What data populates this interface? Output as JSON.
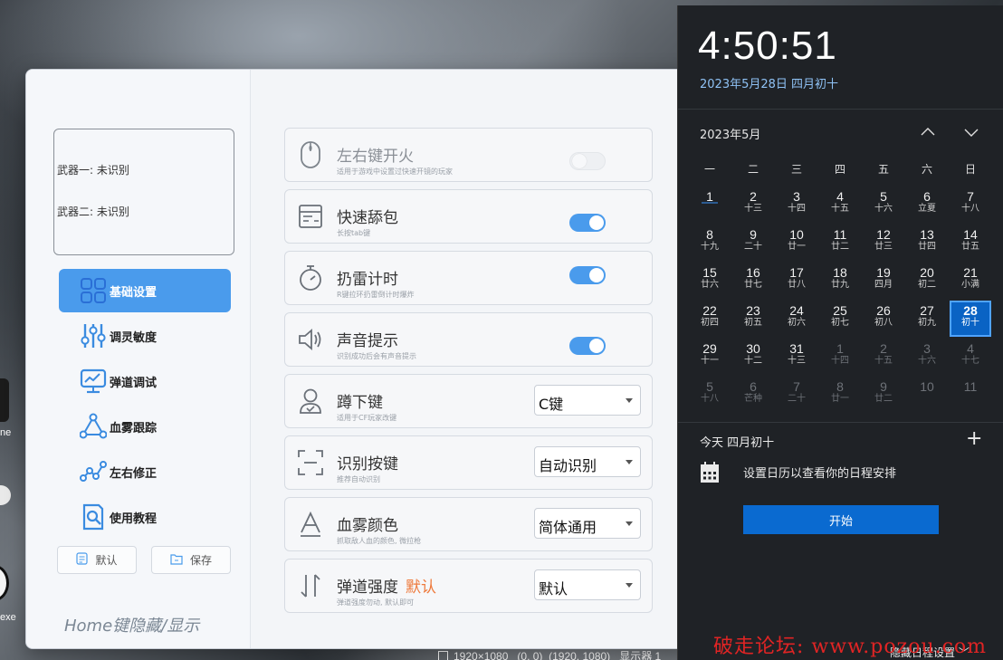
{
  "desktop": {
    "icon1_label": "ne",
    "icon3_label": "exe",
    "screen_info": {
      "resolution": "1920×1080",
      "position": "(0, 0)",
      "size": "(1920, 1080)",
      "display": "显示器 1"
    }
  },
  "app": {
    "weapons": {
      "weapon1": "武器一: 未识别",
      "weapon2": "武器二: 未识别"
    },
    "nav": [
      {
        "label": "基础设置",
        "icon": "grid-icon",
        "active": true
      },
      {
        "label": "调灵敏度",
        "icon": "sliders-icon",
        "active": false
      },
      {
        "label": "弹道调试",
        "icon": "monitor-chart-icon",
        "active": false
      },
      {
        "label": "血雾跟踪",
        "icon": "node-triangle-icon",
        "active": false
      },
      {
        "label": "左右修正",
        "icon": "path-nodes-icon",
        "active": false
      },
      {
        "label": "使用教程",
        "icon": "document-search-icon",
        "active": false
      }
    ],
    "buttons": {
      "default_label": "默认",
      "save_label": "保存"
    },
    "home_hint": "Home键隐藏/显示",
    "rows": [
      {
        "title": "左右键开火",
        "desc": "适用于游戏中设置过快速开镜的玩家",
        "control": "toggle",
        "on": false,
        "disabled": true,
        "icon": "mouse-icon"
      },
      {
        "title": "快速舔包",
        "desc": "长按tab键",
        "control": "toggle",
        "on": true,
        "icon": "list-box-icon"
      },
      {
        "title": "扔雷计时",
        "desc": "R键拉环扔雷倒计时爆炸",
        "control": "toggle",
        "on": true,
        "icon": "stopwatch-icon"
      },
      {
        "title": "声音提示",
        "desc": "识别成功后会有声音提示",
        "control": "toggle",
        "on": true,
        "icon": "speaker-icon"
      },
      {
        "title": "蹲下键",
        "desc": "适用于CF玩家改键",
        "control": "select",
        "value": "C键",
        "icon": "person-icon"
      },
      {
        "title": "识别按键",
        "desc": "推荐自动识别",
        "control": "select",
        "value": "自动识别",
        "icon": "scan-frame-icon"
      },
      {
        "title": "血雾颜色",
        "desc": "抓取敌人血的颜色, 微拉枪",
        "control": "select",
        "value": "简体通用",
        "icon": "letter-a-icon"
      },
      {
        "title": "弹道强度",
        "accent": "默认",
        "desc": "弹道强度勿动, 默认即可",
        "control": "select",
        "value": "默认",
        "icon": "arrows-updown-icon"
      }
    ]
  },
  "calendar": {
    "time": "4:50:51",
    "date_full": "2023年5月28日 四月初十",
    "month_label": "2023年5月",
    "weekdays": [
      "一",
      "二",
      "三",
      "四",
      "五",
      "六",
      "日"
    ],
    "weeks": [
      [
        {
          "n": "1",
          "l": ""
        },
        {
          "n": "2",
          "l": "十三"
        },
        {
          "n": "3",
          "l": "十四"
        },
        {
          "n": "4",
          "l": "十五"
        },
        {
          "n": "5",
          "l": "十六"
        },
        {
          "n": "6",
          "l": "立夏"
        },
        {
          "n": "7",
          "l": "十八"
        }
      ],
      [
        {
          "n": "8",
          "l": "十九"
        },
        {
          "n": "9",
          "l": "二十"
        },
        {
          "n": "10",
          "l": "廿一"
        },
        {
          "n": "11",
          "l": "廿二"
        },
        {
          "n": "12",
          "l": "廿三"
        },
        {
          "n": "13",
          "l": "廿四"
        },
        {
          "n": "14",
          "l": "廿五"
        }
      ],
      [
        {
          "n": "15",
          "l": "廿六"
        },
        {
          "n": "16",
          "l": "廿七"
        },
        {
          "n": "17",
          "l": "廿八"
        },
        {
          "n": "18",
          "l": "廿九"
        },
        {
          "n": "19",
          "l": "四月"
        },
        {
          "n": "20",
          "l": "初二"
        },
        {
          "n": "21",
          "l": "小满"
        }
      ],
      [
        {
          "n": "22",
          "l": "初四"
        },
        {
          "n": "23",
          "l": "初五"
        },
        {
          "n": "24",
          "l": "初六"
        },
        {
          "n": "25",
          "l": "初七"
        },
        {
          "n": "26",
          "l": "初八"
        },
        {
          "n": "27",
          "l": "初九"
        },
        {
          "n": "28",
          "l": "初十",
          "today": true
        }
      ],
      [
        {
          "n": "29",
          "l": "十一"
        },
        {
          "n": "30",
          "l": "十二"
        },
        {
          "n": "31",
          "l": "十三"
        },
        {
          "n": "1",
          "l": "十四",
          "muted": true
        },
        {
          "n": "2",
          "l": "十五",
          "muted": true
        },
        {
          "n": "3",
          "l": "十六",
          "muted": true
        },
        {
          "n": "4",
          "l": "十七",
          "muted": true
        }
      ],
      [
        {
          "n": "5",
          "l": "十八",
          "muted": true
        },
        {
          "n": "6",
          "l": "芒种",
          "muted": true
        },
        {
          "n": "7",
          "l": "二十",
          "muted": true
        },
        {
          "n": "8",
          "l": "廿一",
          "muted": true
        },
        {
          "n": "9",
          "l": "廿二",
          "muted": true
        },
        {
          "n": "10",
          "l": "",
          "muted": true
        },
        {
          "n": "11",
          "l": "",
          "muted": true
        }
      ]
    ],
    "today_label": "今天 四月初十",
    "plus": "+",
    "agenda_text": "设置日历以查看你的日程安排",
    "start_button": "开始",
    "hide_schedule": "隐藏日程设置 ﹀"
  },
  "watermark": "破走论坛: www.pozou.com",
  "colors": {
    "accent_blue": "#4a9bec",
    "accent_orange": "#ee7a3c",
    "calendar_today": "#0a63c4",
    "watermark_red": "#e02424"
  }
}
